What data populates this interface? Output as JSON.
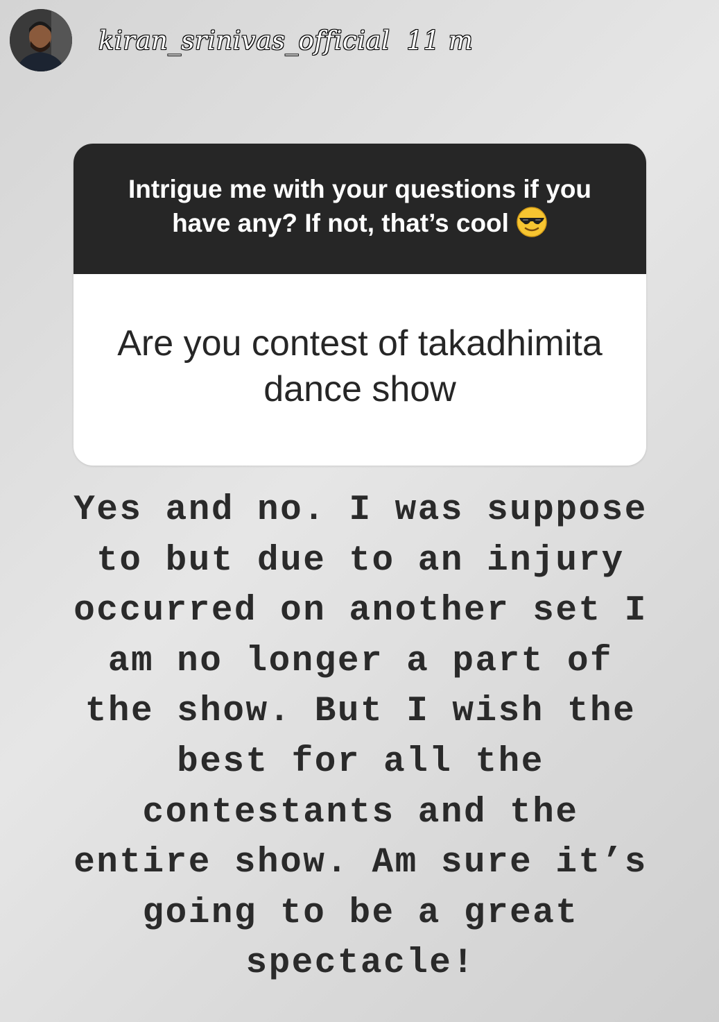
{
  "header": {
    "username": "kiran_srinivas_official",
    "time": "11 m"
  },
  "question_card": {
    "prompt": "Intrigue me with your questions if you have any? If not, that’s cool",
    "prompt_emoji": "smiling-face-with-sunglasses",
    "question": "Are you contest of takadhimita dance show"
  },
  "answer": {
    "text": "Yes and no. I was suppose\nto but due to an injury\noccurred on another set I\nam no longer a part of\nthe show. But I wish the\nbest for all the\ncontestants and the\nentire show. Am sure it’s\ngoing to be a great\nspectacle!"
  },
  "colors": {
    "card_header_bg": "#262626",
    "card_body_bg": "#ffffff",
    "answer_text": "#2a2a2a"
  }
}
